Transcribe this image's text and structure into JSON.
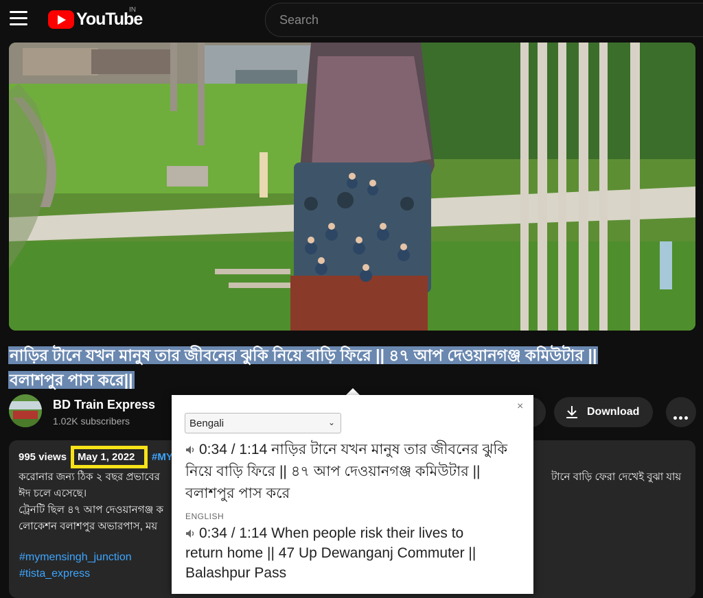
{
  "header": {
    "logo_text": "YouTube",
    "country_code": "IN",
    "search_placeholder": "Search"
  },
  "video": {
    "title_line1": "নাড়ির টানে যখন মানুষ তার জীবনের ঝুকি নিয়ে বাড়ি ফিরে || ৪৭ আপ দেওয়ানগঞ্জ কমিউটার ||",
    "title_line2": "বলাশপুর পাস করে||"
  },
  "channel": {
    "name": "BD Train Express",
    "subscribers": "1.02K subscribers"
  },
  "actions": {
    "download_label": "Download"
  },
  "description": {
    "views": "995 views",
    "date": "May 1, 2022",
    "tag_partial": "#MYM",
    "line1_left": "করোনার জন্য ঠিক ২ বছর প্রভাবের",
    "line1_right": "টানে বাড়ি ফেরা দেখেই বুঝা যায়",
    "line2": "ঈদ চলে এসেছে।",
    "line3": "ট্রেনটি ছিল ৪৭ আপ দেওয়ানগঞ্জ ক",
    "line4": "লোকেশন বলাশপুর অভারপাস, ময়",
    "hashtags": [
      "#mymensingh_junction",
      "#tista_express"
    ]
  },
  "translate_popup": {
    "close_symbol": "×",
    "source_language": "Bengali",
    "source_time": "0:34 / 1:14",
    "source_text_l1": "নাড়ির টানে যখন মানুষ তার জীবনের ঝুকি",
    "source_text_l2": "নিয়ে বাড়ি ফিরে || ৪৭ আপ দেওয়ানগঞ্জ কমিউটার ||",
    "source_text_l3": "বলাশপুর পাস করে",
    "target_language_label": "ENGLISH",
    "target_time": "0:34 / 1:14",
    "target_text_l1": "When people risk their lives to",
    "target_text_l2": "return home || 47 Up Dewanganj Commuter ||",
    "target_text_l3": "Balashpur Pass"
  },
  "colors": {
    "brand_red": "#ff0000",
    "link_blue": "#3ea6ff",
    "highlight_yellow": "#f7e21a",
    "selection_blue": "#6a88b0"
  },
  "icons": [
    "menu-icon",
    "youtube-logo-icon",
    "download-icon",
    "more-options-icon",
    "speaker-icon",
    "close-icon",
    "chevron-down-icon"
  ]
}
